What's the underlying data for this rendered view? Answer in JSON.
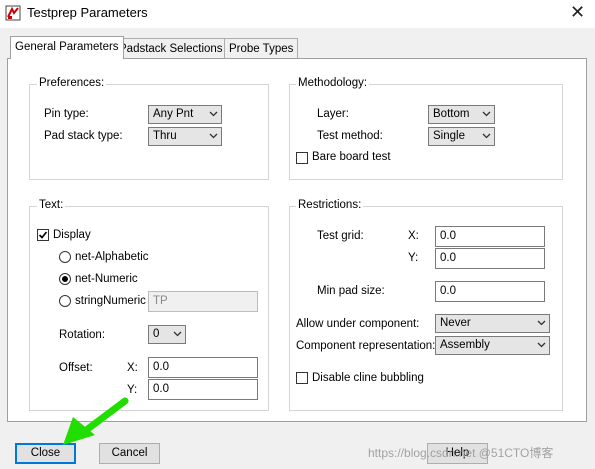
{
  "window": {
    "title": "Testprep Parameters",
    "close_glyph": "✕"
  },
  "tabs": [
    {
      "label": "General Parameters",
      "active": true
    },
    {
      "label": "Padstack Selections",
      "active": false
    },
    {
      "label": "Probe Types",
      "active": false
    }
  ],
  "preferences": {
    "title": "Preferences:",
    "pin_type_label": "Pin type:",
    "pin_type_value": "Any Pnt",
    "pad_stack_type_label": "Pad stack type:",
    "pad_stack_type_value": "Thru"
  },
  "methodology": {
    "title": "Methodology:",
    "layer_label": "Layer:",
    "layer_value": "Bottom",
    "test_method_label": "Test method:",
    "test_method_value": "Single",
    "bare_board_label": "Bare board test",
    "bare_board_checked": false
  },
  "text": {
    "title": "Text:",
    "display_label": "Display",
    "display_checked": true,
    "options": [
      {
        "label": "net-Alphabetic",
        "selected": false
      },
      {
        "label": "net-Numeric",
        "selected": true
      },
      {
        "label": "stringNumeric",
        "selected": false
      }
    ],
    "string_value": "TP",
    "rotation_label": "Rotation:",
    "rotation_value": "0",
    "offset_label": "Offset:",
    "x_label": "X:",
    "x_value": "0.0",
    "y_label": "Y:",
    "y_value": "0.0"
  },
  "restrictions": {
    "title": "Restrictions:",
    "test_grid_label": "Test grid:",
    "x_label": "X:",
    "x_value": "0.0",
    "y_label": "Y:",
    "y_value": "0.0",
    "min_pad_label": "Min pad size:",
    "min_pad_value": "0.0",
    "allow_under_label": "Allow under component:",
    "allow_under_value": "Never",
    "comp_rep_label": "Component representation:",
    "comp_rep_value": "Assembly",
    "disable_cline_label": "Disable cline bubbling",
    "disable_cline_checked": false
  },
  "buttons": {
    "close": "Close",
    "cancel": "Cancel",
    "help": "Help"
  },
  "watermark": "https://blog.csdn.net @51CTO博客",
  "colors": {
    "arrow": "#22dd00",
    "focus": "#0078d7"
  }
}
